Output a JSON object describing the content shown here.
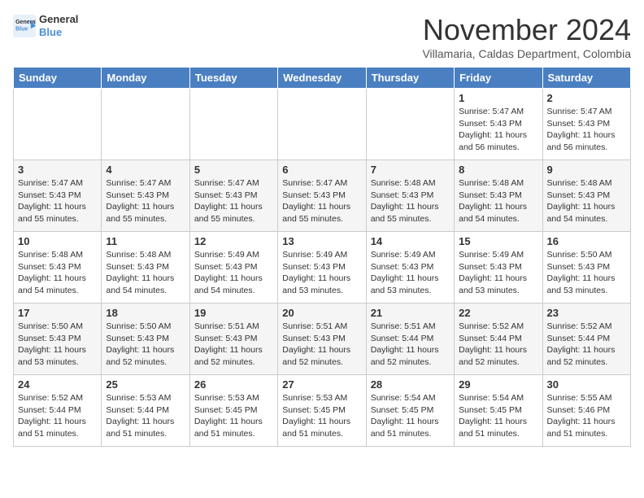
{
  "logo": {
    "line1": "General",
    "line2": "Blue"
  },
  "header": {
    "month": "November 2024",
    "location": "Villamaria, Caldas Department, Colombia"
  },
  "weekdays": [
    "Sunday",
    "Monday",
    "Tuesday",
    "Wednesday",
    "Thursday",
    "Friday",
    "Saturday"
  ],
  "weeks": [
    [
      {
        "day": "",
        "info": ""
      },
      {
        "day": "",
        "info": ""
      },
      {
        "day": "",
        "info": ""
      },
      {
        "day": "",
        "info": ""
      },
      {
        "day": "",
        "info": ""
      },
      {
        "day": "1",
        "info": "Sunrise: 5:47 AM\nSunset: 5:43 PM\nDaylight: 11 hours\nand 56 minutes."
      },
      {
        "day": "2",
        "info": "Sunrise: 5:47 AM\nSunset: 5:43 PM\nDaylight: 11 hours\nand 56 minutes."
      }
    ],
    [
      {
        "day": "3",
        "info": "Sunrise: 5:47 AM\nSunset: 5:43 PM\nDaylight: 11 hours\nand 55 minutes."
      },
      {
        "day": "4",
        "info": "Sunrise: 5:47 AM\nSunset: 5:43 PM\nDaylight: 11 hours\nand 55 minutes."
      },
      {
        "day": "5",
        "info": "Sunrise: 5:47 AM\nSunset: 5:43 PM\nDaylight: 11 hours\nand 55 minutes."
      },
      {
        "day": "6",
        "info": "Sunrise: 5:47 AM\nSunset: 5:43 PM\nDaylight: 11 hours\nand 55 minutes."
      },
      {
        "day": "7",
        "info": "Sunrise: 5:48 AM\nSunset: 5:43 PM\nDaylight: 11 hours\nand 55 minutes."
      },
      {
        "day": "8",
        "info": "Sunrise: 5:48 AM\nSunset: 5:43 PM\nDaylight: 11 hours\nand 54 minutes."
      },
      {
        "day": "9",
        "info": "Sunrise: 5:48 AM\nSunset: 5:43 PM\nDaylight: 11 hours\nand 54 minutes."
      }
    ],
    [
      {
        "day": "10",
        "info": "Sunrise: 5:48 AM\nSunset: 5:43 PM\nDaylight: 11 hours\nand 54 minutes."
      },
      {
        "day": "11",
        "info": "Sunrise: 5:48 AM\nSunset: 5:43 PM\nDaylight: 11 hours\nand 54 minutes."
      },
      {
        "day": "12",
        "info": "Sunrise: 5:49 AM\nSunset: 5:43 PM\nDaylight: 11 hours\nand 54 minutes."
      },
      {
        "day": "13",
        "info": "Sunrise: 5:49 AM\nSunset: 5:43 PM\nDaylight: 11 hours\nand 53 minutes."
      },
      {
        "day": "14",
        "info": "Sunrise: 5:49 AM\nSunset: 5:43 PM\nDaylight: 11 hours\nand 53 minutes."
      },
      {
        "day": "15",
        "info": "Sunrise: 5:49 AM\nSunset: 5:43 PM\nDaylight: 11 hours\nand 53 minutes."
      },
      {
        "day": "16",
        "info": "Sunrise: 5:50 AM\nSunset: 5:43 PM\nDaylight: 11 hours\nand 53 minutes."
      }
    ],
    [
      {
        "day": "17",
        "info": "Sunrise: 5:50 AM\nSunset: 5:43 PM\nDaylight: 11 hours\nand 53 minutes."
      },
      {
        "day": "18",
        "info": "Sunrise: 5:50 AM\nSunset: 5:43 PM\nDaylight: 11 hours\nand 52 minutes."
      },
      {
        "day": "19",
        "info": "Sunrise: 5:51 AM\nSunset: 5:43 PM\nDaylight: 11 hours\nand 52 minutes."
      },
      {
        "day": "20",
        "info": "Sunrise: 5:51 AM\nSunset: 5:43 PM\nDaylight: 11 hours\nand 52 minutes."
      },
      {
        "day": "21",
        "info": "Sunrise: 5:51 AM\nSunset: 5:44 PM\nDaylight: 11 hours\nand 52 minutes."
      },
      {
        "day": "22",
        "info": "Sunrise: 5:52 AM\nSunset: 5:44 PM\nDaylight: 11 hours\nand 52 minutes."
      },
      {
        "day": "23",
        "info": "Sunrise: 5:52 AM\nSunset: 5:44 PM\nDaylight: 11 hours\nand 52 minutes."
      }
    ],
    [
      {
        "day": "24",
        "info": "Sunrise: 5:52 AM\nSunset: 5:44 PM\nDaylight: 11 hours\nand 51 minutes."
      },
      {
        "day": "25",
        "info": "Sunrise: 5:53 AM\nSunset: 5:44 PM\nDaylight: 11 hours\nand 51 minutes."
      },
      {
        "day": "26",
        "info": "Sunrise: 5:53 AM\nSunset: 5:45 PM\nDaylight: 11 hours\nand 51 minutes."
      },
      {
        "day": "27",
        "info": "Sunrise: 5:53 AM\nSunset: 5:45 PM\nDaylight: 11 hours\nand 51 minutes."
      },
      {
        "day": "28",
        "info": "Sunrise: 5:54 AM\nSunset: 5:45 PM\nDaylight: 11 hours\nand 51 minutes."
      },
      {
        "day": "29",
        "info": "Sunrise: 5:54 AM\nSunset: 5:45 PM\nDaylight: 11 hours\nand 51 minutes."
      },
      {
        "day": "30",
        "info": "Sunrise: 5:55 AM\nSunset: 5:46 PM\nDaylight: 11 hours\nand 51 minutes."
      }
    ]
  ]
}
